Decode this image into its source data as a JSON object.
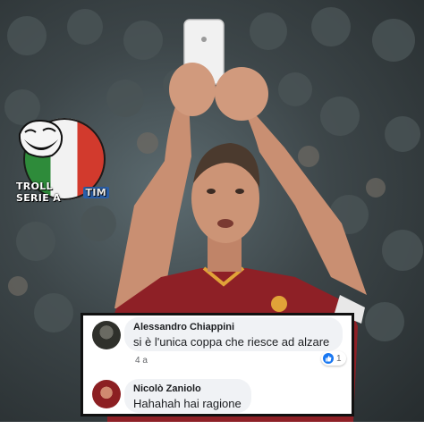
{
  "photo": {
    "subject": "footballer-selfie",
    "colors": {
      "jersey": "#8e2026",
      "jersey_accent": "#e1a338",
      "crowd": "#3d4649",
      "skin": "#c98f72"
    }
  },
  "logo": {
    "brand_text": "TROLL SERIE A",
    "sponsor_text": "TIM"
  },
  "comments": [
    {
      "author": "Alessandro Chiappini",
      "text": "si è l'unica coppa che riesce ad alzare",
      "time": "4 a",
      "reaction_icon": "like-icon",
      "reaction_count": "1"
    },
    {
      "author": "Nicolò Zaniolo",
      "text": "Hahahah hai ragione"
    }
  ]
}
